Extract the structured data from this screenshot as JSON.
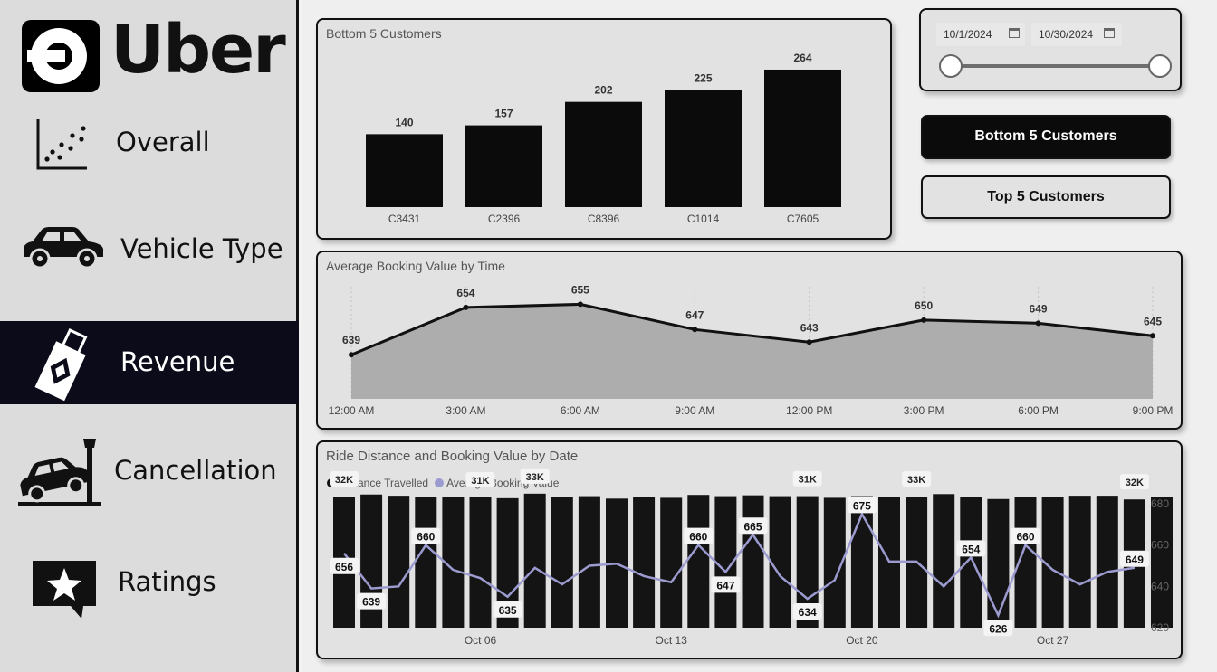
{
  "logo": {
    "text": "Uber"
  },
  "sidebar": {
    "items": [
      {
        "label": "Overall",
        "icon": "scatter-chart-icon"
      },
      {
        "label": "Vehicle Type",
        "icon": "car-icon"
      },
      {
        "label": "Revenue",
        "icon": "money-icon",
        "active": true
      },
      {
        "label": "Cancellation",
        "icon": "car-crash-icon"
      },
      {
        "label": "Ratings",
        "icon": "star-speech-icon"
      }
    ]
  },
  "date_filter": {
    "start": "10/1/2024",
    "end": "10/30/2024",
    "range_fraction": [
      0.0,
      1.0
    ]
  },
  "buttons": {
    "bottom5": "Bottom 5 Customers",
    "top5": "Top 5 Customers"
  },
  "colors": {
    "accent": "#0b0b0b",
    "line": "#9b9bd0",
    "area": "#adadad"
  },
  "chart_data": [
    {
      "type": "bar",
      "title": "Bottom 5 Customers",
      "categories": [
        "C3431",
        "C2396",
        "C8396",
        "C1014",
        "C7605"
      ],
      "values": [
        140,
        157,
        202,
        225,
        264
      ],
      "data_labels": [
        "140",
        "157",
        "202",
        "225",
        "264"
      ],
      "ylim": [
        0,
        290
      ]
    },
    {
      "type": "area",
      "title": "Average Booking Value by Time",
      "categories": [
        "12:00 AM",
        "3:00 AM",
        "6:00 AM",
        "9:00 AM",
        "12:00 PM",
        "3:00 PM",
        "6:00 PM",
        "9:00 PM"
      ],
      "values": [
        639,
        654,
        655,
        647,
        643,
        650,
        649,
        645
      ],
      "data_labels": [
        "639",
        "654",
        "655",
        "647",
        "643",
        "650",
        "649",
        "645"
      ],
      "ylim": [
        625,
        660
      ]
    },
    {
      "type": "bar",
      "title": "Ride Distance and Booking Value by Date",
      "legend": [
        "Distance Travelled",
        "Average Booking Value"
      ],
      "x_ticks": [
        "Oct 06",
        "Oct 13",
        "Oct 20",
        "Oct 27"
      ],
      "x_tick_index": [
        5,
        12,
        19,
        26
      ],
      "y2_ticks": [
        "680",
        "660",
        "640",
        "620"
      ],
      "y2lim": [
        620,
        680
      ],
      "ylim_bars": [
        0,
        34
      ],
      "series": [
        {
          "name": "Distance Travelled",
          "type": "bar",
          "values": [
            31.8,
            32.3,
            32.0,
            31.7,
            31.8,
            31.6,
            31.4,
            32.5,
            31.7,
            31.9,
            31.3,
            31.8,
            31.5,
            32.2,
            31.9,
            32.1,
            31.9,
            31.9,
            31.5,
            31.9,
            31.8,
            31.8,
            32.4,
            31.8,
            31.2,
            31.6,
            31.8,
            32.0,
            32.0,
            31.1,
            31.6
          ],
          "labels": {
            "0": "32K",
            "5": "31K",
            "7": "33K",
            "17": "31K",
            "21": "33K",
            "29": "32K"
          }
        },
        {
          "name": "Average Booking Value",
          "type": "line",
          "values": [
            656,
            639,
            640,
            660,
            648,
            644,
            635,
            649,
            641,
            650,
            651,
            645,
            642,
            660,
            647,
            665,
            645,
            634,
            643,
            675,
            652,
            652,
            640,
            654,
            626,
            660,
            648,
            641,
            647,
            649
          ],
          "labels": {
            "0": "656",
            "1": "639",
            "3": "660",
            "6": "635",
            "13": "660",
            "14": "647",
            "15": "665",
            "17": "634",
            "19": "675",
            "23": "654",
            "24": "626",
            "25": "660",
            "29": "649"
          }
        }
      ]
    }
  ]
}
